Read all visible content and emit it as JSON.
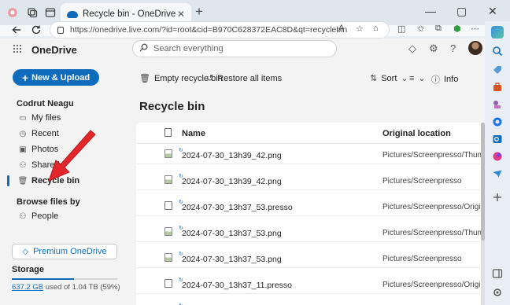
{
  "browser": {
    "tab_title": "Recycle bin - OneDrive",
    "tab_close": "✕",
    "new_tab": "+",
    "url": "https://onedrive.live.com/?id=root&cid=B970C628372EAC8D&qt=recyclebin",
    "window_controls": [
      "—",
      "▢",
      "✕"
    ]
  },
  "app": {
    "brand": "OneDrive",
    "search_placeholder": "Search everything"
  },
  "nav": {
    "new_upload": "New & Upload",
    "user": "Codrut Neagu",
    "items": [
      {
        "label": "My files",
        "icon": "folder-icon"
      },
      {
        "label": "Recent",
        "icon": "clock-icon"
      },
      {
        "label": "Photos",
        "icon": "image-icon"
      },
      {
        "label": "Shared",
        "icon": "people-icon"
      },
      {
        "label": "Recycle bin",
        "icon": "trash-icon"
      }
    ],
    "browse_title": "Browse files by",
    "people": "People",
    "premium": "Premium OneDrive",
    "storage_title": "Storage",
    "storage_used": "637.2 GB",
    "storage_rest": "used of 1.04 TB (59%)",
    "storage_fraction": 0.59
  },
  "commands": {
    "empty": "Empty recycle bin",
    "restore": "Restore all items",
    "sort": "Sort",
    "info": "Info"
  },
  "page": {
    "title": "Recycle bin",
    "columns": {
      "name": "Name",
      "location": "Original location"
    }
  },
  "files": [
    {
      "name": "2024-07-30_13h39_42.png",
      "location": "Pictures/Screenpresso/Thumb",
      "type": "image"
    },
    {
      "name": "2024-07-30_13h39_42.png",
      "location": "Pictures/Screenpresso",
      "type": "image"
    },
    {
      "name": "2024-07-30_13h37_53.presso",
      "location": "Pictures/Screenpresso/Origin",
      "type": "file"
    },
    {
      "name": "2024-07-30_13h37_53.png",
      "location": "Pictures/Screenpresso/Thumb",
      "type": "image"
    },
    {
      "name": "2024-07-30_13h37_53.png",
      "location": "Pictures/Screenpresso",
      "type": "image"
    },
    {
      "name": "2024-07-30_13h37_11.presso",
      "location": "Pictures/Screenpresso/Origin",
      "type": "file"
    },
    {
      "name": "2024-07-30_13h37_11.png",
      "location": "Pictures/Screenpresso/Thumb",
      "type": "image"
    }
  ],
  "colors": {
    "accent": "#0f6cbd",
    "annotation": "#e3262b"
  }
}
